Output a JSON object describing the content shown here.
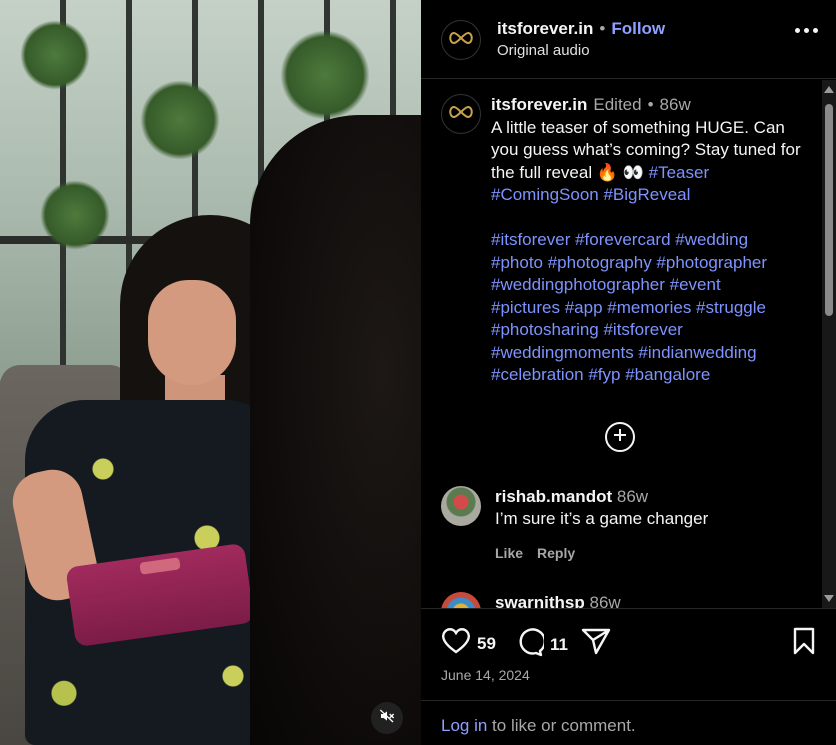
{
  "header": {
    "username": "itsforever.in",
    "separator": "•",
    "follow_label": "Follow",
    "subtitle": "Original audio"
  },
  "caption": {
    "username": "itsforever.in",
    "edited": "Edited",
    "separator": "•",
    "age": "86w",
    "text": "A little teaser of something HUGE. Can you guess what’s coming? Stay tuned for the full reveal 🔥 👀",
    "inline_tags": "#Teaser",
    "tag_line_1": "#ComingSoon #BigReveal",
    "hashtag_lines": [
      "#itsforever #forevercard #wedding",
      "#photo #photography #photographer",
      "#weddingphotographer #event",
      "#pictures #app #memories #struggle",
      "#photosharing #itsforever",
      "#weddingmoments #indianwedding",
      "#celebration #fyp #bangalore"
    ]
  },
  "comments": [
    {
      "user": "rishab.mandot",
      "age": "86w",
      "text": "I’m sure it’s a game changer",
      "like_label": "Like",
      "reply_label": "Reply"
    },
    {
      "user": "swarnithsp",
      "age": "86w"
    }
  ],
  "actions": {
    "likes": "59",
    "comments": "11",
    "date": "June 14, 2024"
  },
  "login": {
    "link": "Log in",
    "rest": " to like or comment."
  },
  "colors": {
    "accent": "#8ea0ff",
    "hashtag": "#7d93ff",
    "muted": "#a8a8a8",
    "background": "#000000"
  },
  "icons": {
    "mute": "speaker-muted-icon",
    "like": "heart-icon",
    "comment": "comment-bubble-icon",
    "share": "paper-plane-icon",
    "save": "bookmark-icon",
    "load_more": "plus-circle-icon",
    "more": "more-horizontal-icon",
    "avatar": "infinity-logo-icon"
  }
}
